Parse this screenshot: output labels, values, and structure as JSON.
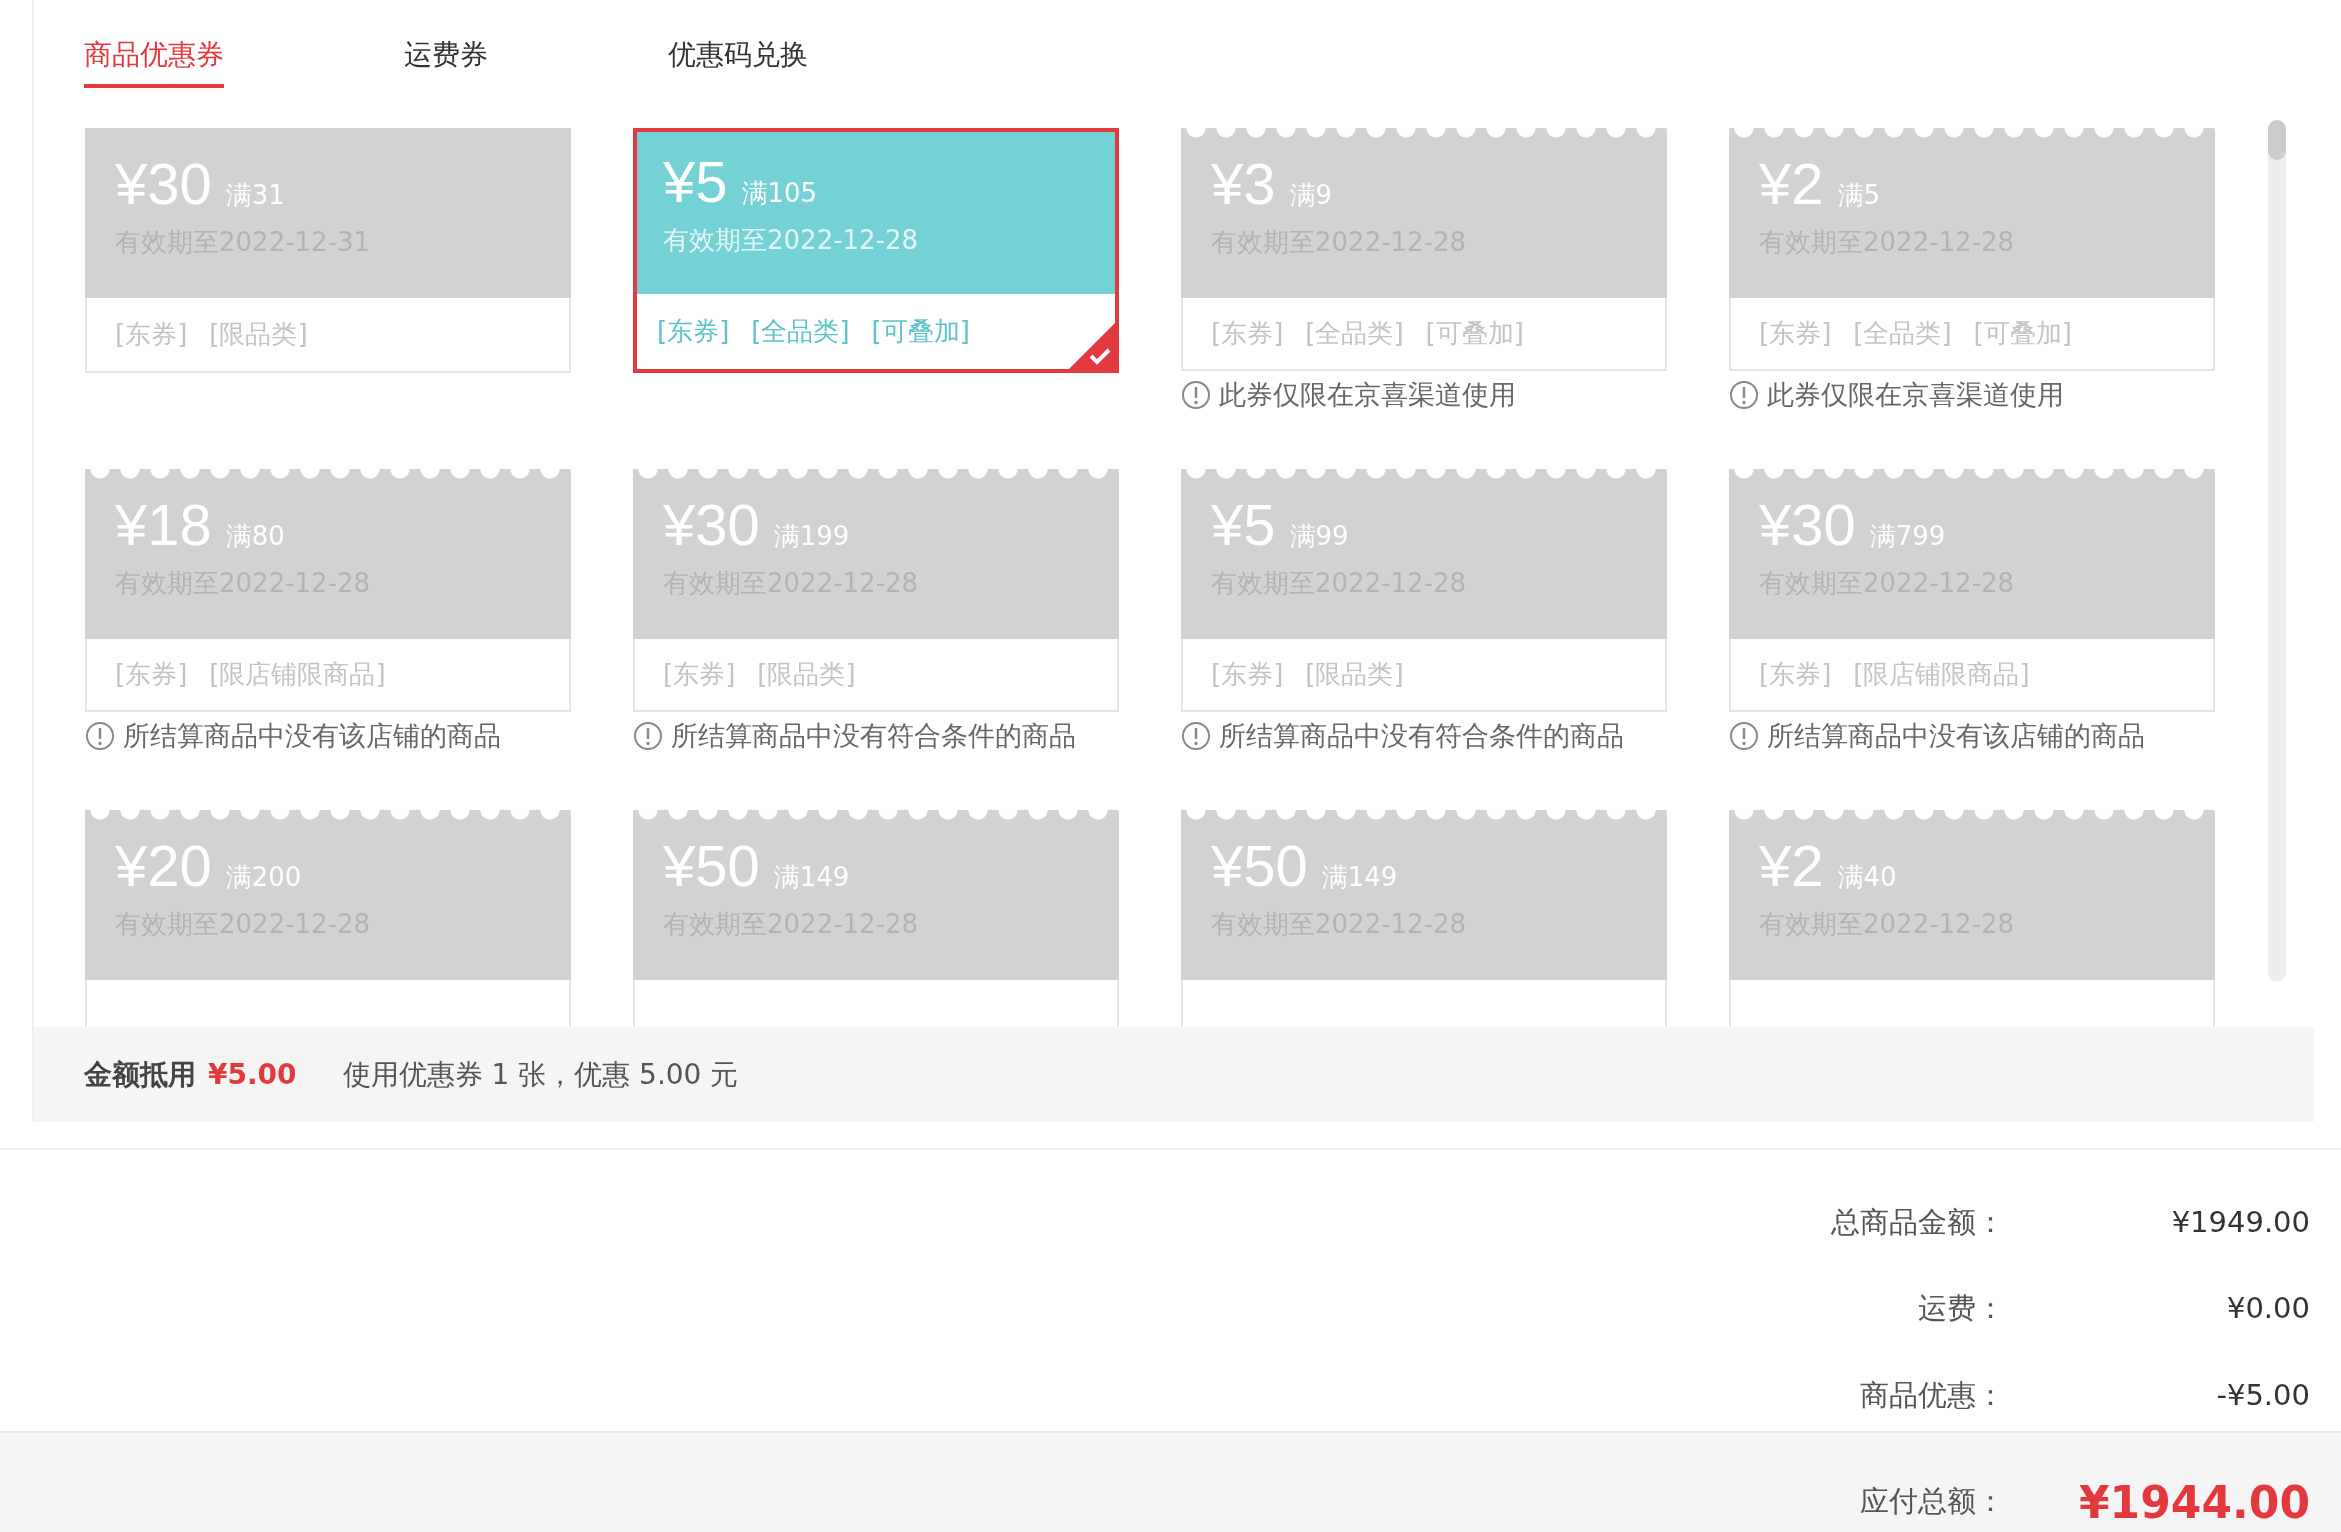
{
  "tabs": [
    {
      "label": "商品优惠券",
      "selected": true
    },
    {
      "label": "运费券",
      "selected": false
    },
    {
      "label": "优惠码兑换",
      "selected": false
    }
  ],
  "coupons": [
    {
      "amount": "¥30",
      "threshold": "满31",
      "expiry": "有效期至2022-12-31",
      "tags": [
        "[东券]",
        "[限品类]"
      ],
      "notched": false,
      "selected": false
    },
    {
      "amount": "¥5",
      "threshold": "满105",
      "expiry": "有效期至2022-12-28",
      "tags": [
        "[东券]",
        "[全品类]",
        "[可叠加]"
      ],
      "notched": false,
      "selected": true
    },
    {
      "amount": "¥3",
      "threshold": "满9",
      "expiry": "有效期至2022-12-28",
      "tags": [
        "[东券]",
        "[全品类]",
        "[可叠加]"
      ],
      "note": "此券仅限在京喜渠道使用",
      "notched": true,
      "selected": false
    },
    {
      "amount": "¥2",
      "threshold": "满5",
      "expiry": "有效期至2022-12-28",
      "tags": [
        "[东券]",
        "[全品类]",
        "[可叠加]"
      ],
      "note": "此券仅限在京喜渠道使用",
      "notched": true,
      "selected": false
    },
    {
      "amount": "¥18",
      "threshold": "满80",
      "expiry": "有效期至2022-12-28",
      "tags": [
        "[东券]",
        "[限店铺限商品]"
      ],
      "note": "所结算商品中没有该店铺的商品",
      "notched": true,
      "selected": false
    },
    {
      "amount": "¥30",
      "threshold": "满199",
      "expiry": "有效期至2022-12-28",
      "tags": [
        "[东券]",
        "[限品类]"
      ],
      "note": "所结算商品中没有符合条件的商品",
      "notched": true,
      "selected": false
    },
    {
      "amount": "¥5",
      "threshold": "满99",
      "expiry": "有效期至2022-12-28",
      "tags": [
        "[东券]",
        "[限品类]"
      ],
      "note": "所结算商品中没有符合条件的商品",
      "notched": true,
      "selected": false
    },
    {
      "amount": "¥30",
      "threshold": "满799",
      "expiry": "有效期至2022-12-28",
      "tags": [
        "[东券]",
        "[限店铺限商品]"
      ],
      "note": "所结算商品中没有该店铺的商品",
      "notched": true,
      "selected": false
    },
    {
      "amount": "¥20",
      "threshold": "满200",
      "expiry": "有效期至2022-12-28",
      "notched": true,
      "selected": false
    },
    {
      "amount": "¥50",
      "threshold": "满149",
      "expiry": "有效期至2022-12-28",
      "notched": true,
      "selected": false
    },
    {
      "amount": "¥50",
      "threshold": "满149",
      "expiry": "有效期至2022-12-28",
      "notched": true,
      "selected": false
    },
    {
      "amount": "¥2",
      "threshold": "满40",
      "expiry": "有效期至2022-12-28",
      "notched": true,
      "selected": false
    }
  ],
  "summary": {
    "label": "金额抵用",
    "amount": "¥5.00",
    "detail": "使用优惠券 1 张，优惠 5.00 元"
  },
  "price_rows": [
    {
      "label": "总商品金额：",
      "value": "¥1949.00"
    },
    {
      "label": "运费：",
      "value": "¥0.00"
    },
    {
      "label": "商品优惠：",
      "value": "-¥5.00"
    }
  ],
  "total": {
    "label": "应付总额：",
    "value": "¥1944.00"
  }
}
